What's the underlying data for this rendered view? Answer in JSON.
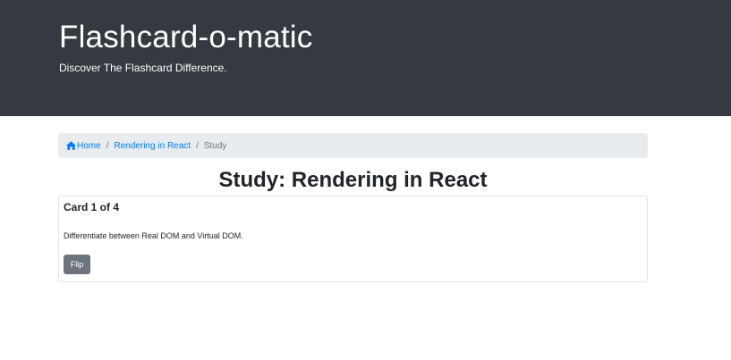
{
  "header": {
    "title": "Flashcard-o-matic",
    "subtitle": "Discover The Flashcard Difference."
  },
  "breadcrumb": {
    "home_label": "Home",
    "home_icon": "home-icon",
    "deck_label": "Rendering in React",
    "current_label": "Study",
    "separator": "/"
  },
  "page": {
    "title": "Study: Rendering in React"
  },
  "card": {
    "progress": "Card 1 of 4",
    "front_text": "Differentiate between Real DOM and Virtual DOM.",
    "flip_label": "Flip"
  },
  "colors": {
    "header_bg": "#343a40",
    "link": "#007bff",
    "breadcrumb_bg": "#e9ecef",
    "button_secondary": "#6c757d"
  }
}
